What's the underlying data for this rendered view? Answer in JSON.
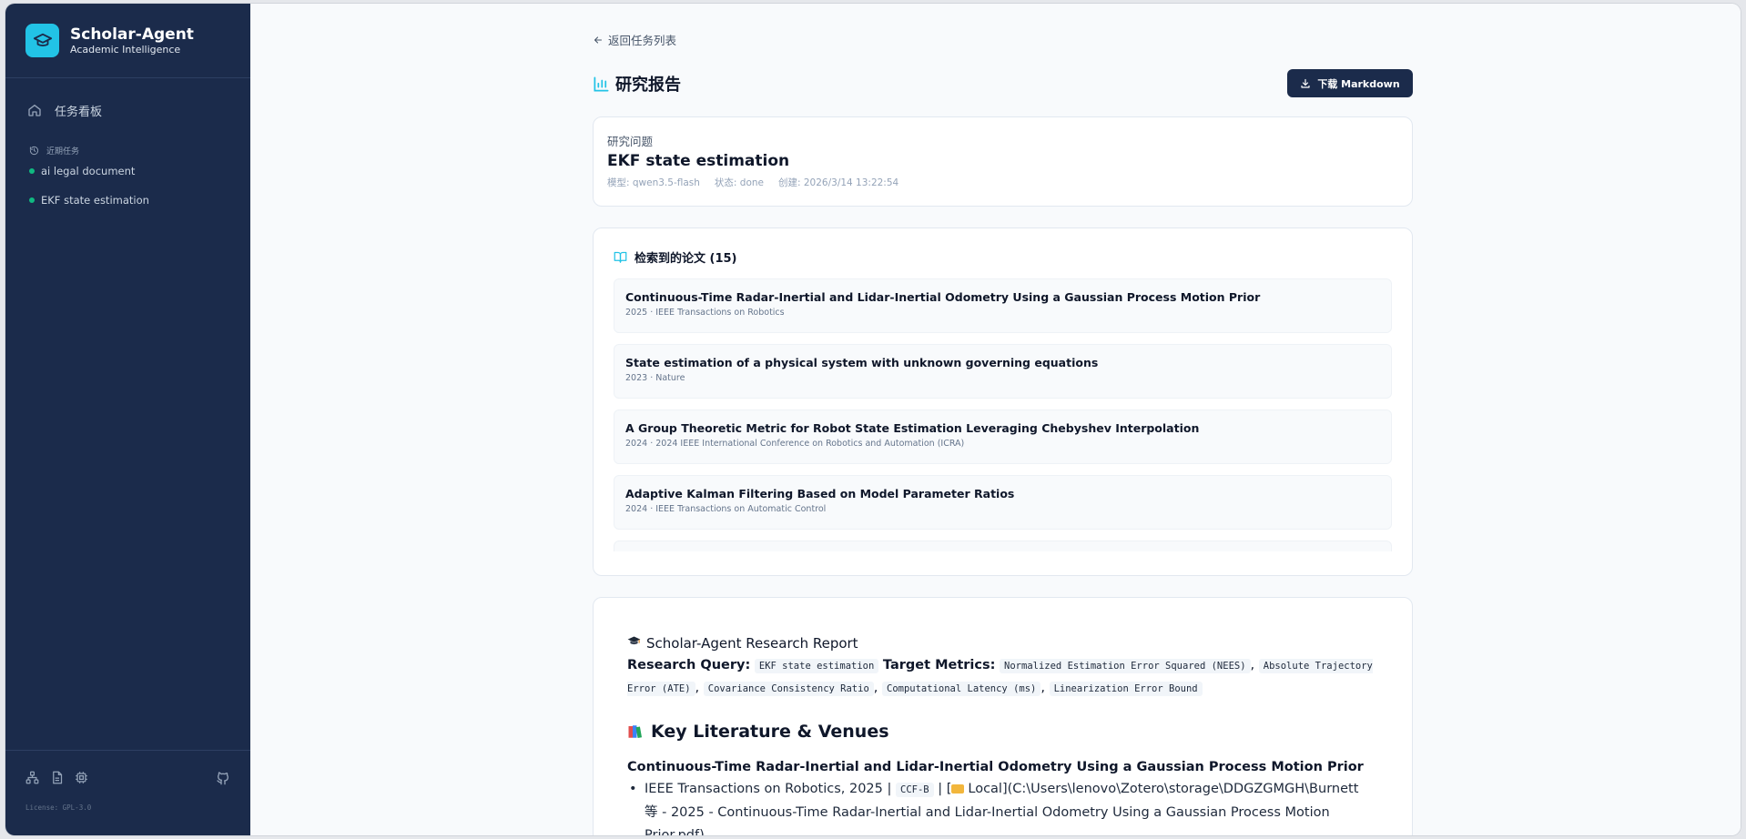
{
  "brand": {
    "name": "Scholar-Agent",
    "subtitle": "Academic Intelligence"
  },
  "sidebar": {
    "nav": [
      {
        "label": "任务看板",
        "icon": "home-icon"
      }
    ],
    "recent_header": "近期任务",
    "recent_tasks": [
      {
        "label": "ai legal document",
        "status_color": "#10b981"
      },
      {
        "label": "EKF state estimation",
        "status_color": "#10b981"
      }
    ],
    "footer_icons": [
      "network-icon",
      "document-icon",
      "chip-icon"
    ],
    "github_icon": "github-icon",
    "license": "License: GPL-3.0"
  },
  "header": {
    "back_label": "返回任务列表",
    "page_title": "研究报告",
    "download_label": "下载 Markdown"
  },
  "question": {
    "label": "研究问题",
    "text": "EKF state estimation",
    "model": "模型: qwen3.5-flash",
    "status": "状态: done",
    "created": "创建: 2026/3/14 13:22:54"
  },
  "papers": {
    "header": "检索到的论文 (15)",
    "items": [
      {
        "title": "Continuous-Time Radar-Inertial and Lidar-Inertial Odometry Using a Gaussian Process Motion Prior",
        "meta": "2025 · IEEE Transactions on Robotics"
      },
      {
        "title": "State estimation of a physical system with unknown governing equations",
        "meta": "2023 · Nature"
      },
      {
        "title": "A Group Theoretic Metric for Robot State Estimation Leveraging Chebyshev Interpolation",
        "meta": "2024 · 2024 IEEE International Conference on Robotics and Automation (ICRA)"
      },
      {
        "title": "Adaptive Kalman Filtering Based on Model Parameter Ratios",
        "meta": "2024 · IEEE Transactions on Automatic Control"
      },
      {
        "title": "",
        "meta": ""
      }
    ]
  },
  "report": {
    "title": "Scholar-Agent Research Report",
    "query_label": "Research Query:",
    "query_value": "EKF state estimation",
    "metrics_label": "Target Metrics:",
    "metrics": [
      "Normalized Estimation Error Squared (NEES)",
      "Absolute Trajectory Error (ATE)",
      "Covariance Consistency Ratio",
      "Computational Latency (ms)",
      "Linearization Error Bound"
    ],
    "section_heading": "Key Literature & Venues",
    "paper_heading": "Continuous-Time Radar-Inertial and Lidar-Inertial Odometry Using a Gaussian Process Motion Prior",
    "bullet_prefix": "IEEE Transactions on Robotics, 2025 |",
    "bullet_code": "CCF-B",
    "bullet_mid": "| [",
    "bullet_path": "Local](C:\\Users\\lenovo\\Zotero\\storage\\DDGZGMGH\\Burnett",
    "bullet_line2": "等 - 2025 - Continuous-Time Radar-Inertial and Lidar-Inertial Odometry Using a Gaussian Process Motion",
    "bullet_line3": "Prior.pdf)"
  },
  "colors": {
    "sidebar_bg": "#1b2b4b",
    "accent": "#22c3e6",
    "status_dot": "#10b981"
  }
}
